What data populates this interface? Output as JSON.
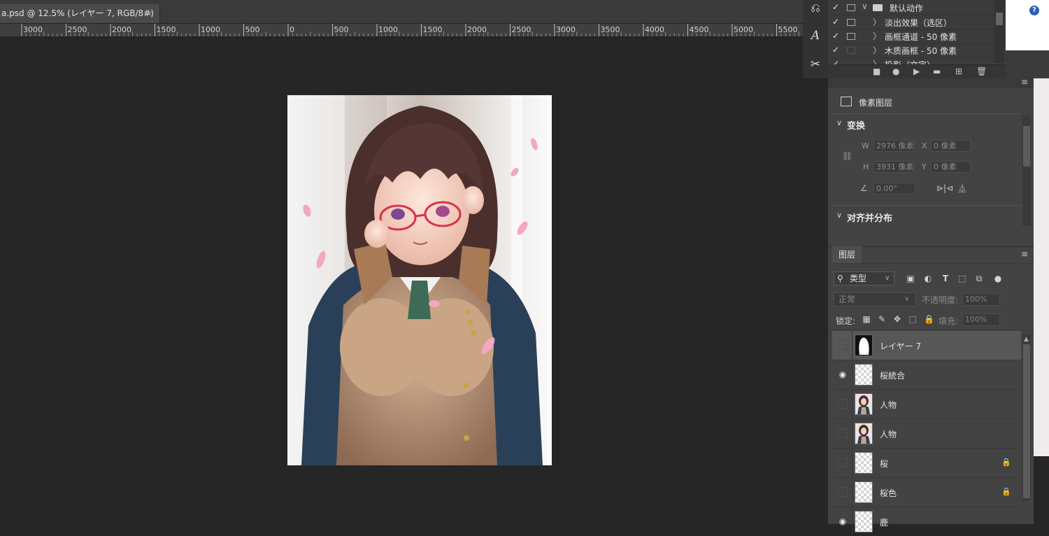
{
  "document_tab": {
    "title": "a.psd @ 12.5% (レイヤー 7, RGB/8#)",
    "close_glyph": "×"
  },
  "ruler": {
    "labels": [
      "3000",
      "2500",
      "2000",
      "1500",
      "1000",
      "500",
      "0",
      "500",
      "1000",
      "1500",
      "2000",
      "2500",
      "3000",
      "3500",
      "4000",
      "4500",
      "5000",
      "5500"
    ]
  },
  "tools": [
    {
      "name": "history-brush-icon",
      "glyph": "⎌"
    },
    {
      "name": "type-icon",
      "glyph": "A"
    },
    {
      "name": "scissors-icon",
      "glyph": "✂"
    }
  ],
  "actions_panel": {
    "rows": [
      {
        "check": "✓",
        "arrow": "∨",
        "label": "默认动作",
        "folder": true
      },
      {
        "check": "✓",
        "arrow": "〉",
        "label": "淡出效果（选区）"
      },
      {
        "check": "✓",
        "arrow": "〉",
        "label": "画框通道 - 50 像素"
      },
      {
        "check": "✓",
        "arrow": "〉",
        "label": "木质画框 - 50 像素"
      },
      {
        "check": "✓",
        "arrow": "〉",
        "label": "投影（文字）"
      }
    ],
    "footer": [
      "■",
      "●",
      "▶",
      "▬",
      "⊞",
      "🗑"
    ]
  },
  "properties_panel": {
    "kind": "像素图层",
    "transform": {
      "title": "变换",
      "w_label": "W",
      "w_value": "2976 像素",
      "x_label": "X",
      "x_value": "0 像素",
      "h_label": "H",
      "h_value": "3931 像素",
      "y_label": "Y",
      "y_value": "0 像素",
      "angle_value": "0.00°"
    },
    "align": {
      "title": "对齐并分布"
    }
  },
  "layers_panel": {
    "tab": "图层",
    "kind_filter": "类型",
    "blend_mode": "正常",
    "opacity_label": "不透明度:",
    "opacity_value": "100%",
    "lock_label": "锁定:",
    "fill_label": "填充:",
    "fill_value": "100%",
    "layers": [
      {
        "name": "レイヤー 7",
        "visible": false,
        "selected": true,
        "locked": false,
        "thumb": "mask"
      },
      {
        "name": "桜統合",
        "visible": true,
        "selected": false,
        "locked": false,
        "thumb": "transparent"
      },
      {
        "name": "人物",
        "visible": false,
        "selected": false,
        "locked": false,
        "thumb": "figure"
      },
      {
        "name": "人物",
        "visible": false,
        "selected": false,
        "locked": false,
        "thumb": "figure"
      },
      {
        "name": "桜",
        "visible": false,
        "selected": false,
        "locked": true,
        "thumb": "transparent"
      },
      {
        "name": "桜色",
        "visible": false,
        "selected": false,
        "locked": true,
        "thumb": "transparent"
      },
      {
        "name": "鹿",
        "visible": true,
        "selected": false,
        "locked": false,
        "thumb": "transparent"
      }
    ]
  }
}
